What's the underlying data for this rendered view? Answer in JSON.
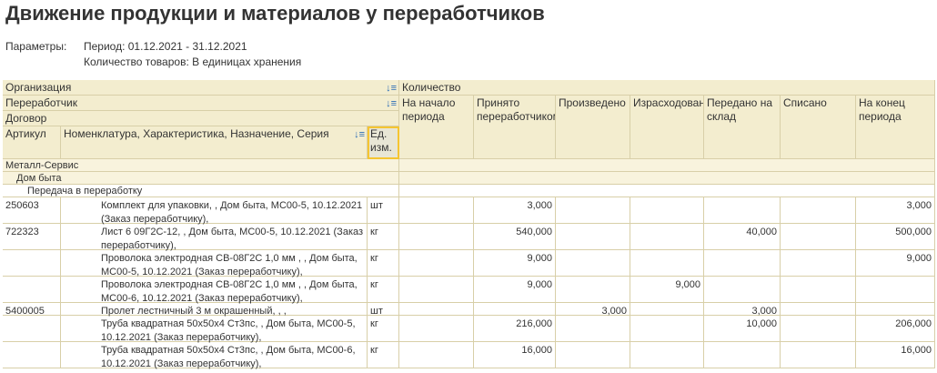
{
  "title": "Движение продукции и материалов у переработчиков",
  "params": {
    "label": "Параметры:",
    "period": "Период: 01.12.2021 - 31.12.2021",
    "qty": "Количество товаров: В единицах хранения"
  },
  "header": {
    "org": "Организация",
    "processor": "Переработчик",
    "contract": "Договор",
    "article": "Артикул",
    "nomenclature": "Номенклатура, Характеристика, Назначение, Серия",
    "unit": "Ед. изм.",
    "quantity": "Количество",
    "cols": [
      "На начало периода",
      "Принято переработчиком",
      "Произведено",
      "Израсходовано",
      "Передано на склад",
      "Списано",
      "На конец периода"
    ],
    "sort_icon": "sort-desc-icon"
  },
  "groups": {
    "org": "Металл-Сервис",
    "processor": "Дом быта",
    "contract": "Передача в переработку"
  },
  "rows": [
    {
      "article": "250603",
      "name": "Комплект для упаковки, , Дом быта, МС00-5, 10.12.2021 (Заказ переработчику),",
      "unit": "шт",
      "v": [
        "",
        "3,000",
        "",
        "",
        "",
        "",
        "3,000"
      ]
    },
    {
      "article": "722323",
      "name": "Лист 6 09Г2С-12, , Дом быта, МС00-5, 10.12.2021 (Заказ переработчику),",
      "unit": "кг",
      "v": [
        "",
        "540,000",
        "",
        "",
        "40,000",
        "",
        "500,000"
      ]
    },
    {
      "article": "",
      "name": "Проволока электродная СВ-08Г2С 1,0 мм , , Дом быта, МС00-5, 10.12.2021 (Заказ переработчику),",
      "unit": "кг",
      "v": [
        "",
        "9,000",
        "",
        "",
        "",
        "",
        "9,000"
      ]
    },
    {
      "article": "",
      "name": "Проволока электродная СВ-08Г2С 1,0 мм , , Дом быта, МС00-6, 10.12.2021 (Заказ переработчику),",
      "unit": "кг",
      "v": [
        "",
        "9,000",
        "",
        "9,000",
        "",
        "",
        ""
      ]
    },
    {
      "article": "5400005",
      "name": "Пролет лестничный 3 м окрашенный, , ,",
      "unit": "шт",
      "v": [
        "",
        "",
        "3,000",
        "",
        "3,000",
        "",
        ""
      ]
    },
    {
      "article": "",
      "name": "Труба квадратная 50х50х4 Ст3пс, , Дом быта, МС00-5, 10.12.2021 (Заказ переработчику),",
      "unit": "кг",
      "v": [
        "",
        "216,000",
        "",
        "",
        "10,000",
        "",
        "206,000"
      ]
    },
    {
      "article": "",
      "name": "Труба квадратная 50х50х4 Ст3пс, , Дом быта, МС00-6, 10.12.2021 (Заказ переработчику),",
      "unit": "кг",
      "v": [
        "",
        "16,000",
        "",
        "",
        "",
        "",
        "16,000"
      ]
    }
  ]
}
